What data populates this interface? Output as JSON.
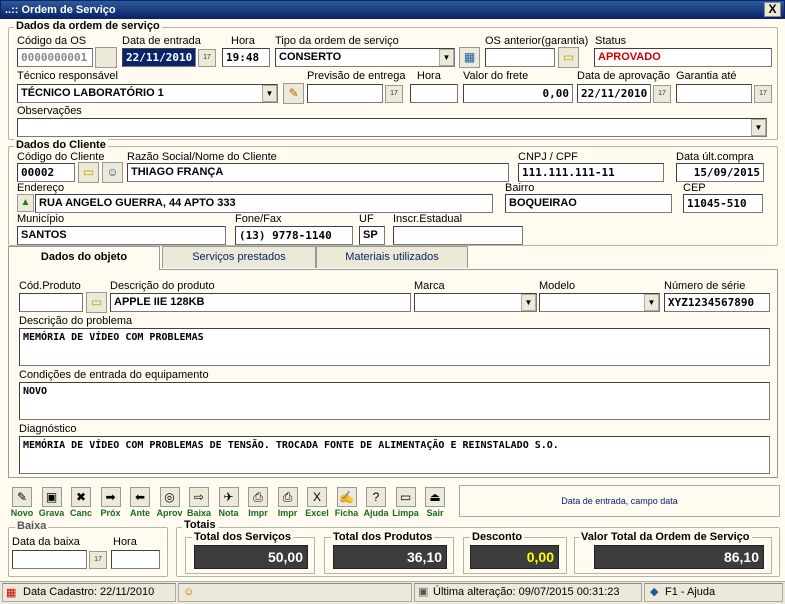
{
  "window": {
    "title": "..:: Ordem de Serviço",
    "close": "X"
  },
  "os": {
    "legend": "Dados da ordem de serviço",
    "codigo_label": "Código da OS",
    "codigo_value": "0000000001",
    "data_entrada_label": "Data de entrada",
    "data_entrada_value": "22/11/2010",
    "hora_label": "Hora",
    "hora_value": "19:48",
    "tipo_label": "Tipo da ordem de serviço",
    "tipo_value": "CONSERTO",
    "os_anterior_label": "OS anterior(garantia)",
    "os_anterior_value": "",
    "status_label": "Status",
    "status_value": "APROVADO",
    "tecnico_label": "Técnico responsável",
    "tecnico_value": "TÉCNICO LABORATÓRIO 1",
    "previsao_label": "Previsão de entrega",
    "previsao_value": "",
    "hora2_label": "Hora",
    "hora2_value": "",
    "frete_label": "Valor do frete",
    "frete_value": "0,00",
    "aprovacao_label": "Data de aprovação",
    "aprovacao_value": "22/11/2010",
    "garantia_label": "Garantia até",
    "garantia_value": "",
    "obs_label": "Observações",
    "obs_value": ""
  },
  "cliente": {
    "legend": "Dados do Cliente",
    "codigo_label": "Código do Cliente",
    "codigo_value": "00002",
    "razao_label": "Razão Social/Nome do Cliente",
    "razao_value": "THIAGO FRANÇA",
    "cnpj_label": "CNPJ / CPF",
    "cnpj_value": "111.111.111-11",
    "ultcompra_label": "Data últ.compra",
    "ultcompra_value": "15/09/2015",
    "endereco_label": "Endereço",
    "endereco_value": "RUA ANGELO GUERRA, 44 APTO 333",
    "bairro_label": "Bairro",
    "bairro_value": "BOQUEIRAO",
    "cep_label": "CEP",
    "cep_value": "11045-510",
    "municipio_label": "Município",
    "municipio_value": "SANTOS",
    "fone_label": "Fone/Fax",
    "fone_value": "(13) 9778-1140",
    "uf_label": "UF",
    "uf_value": "SP",
    "ie_label": "Inscr.Estadual",
    "ie_value": ""
  },
  "tabs": [
    {
      "label": "Dados do objeto"
    },
    {
      "label": "Serviços prestados"
    },
    {
      "label": "Materiais utilizados"
    }
  ],
  "objeto": {
    "cod_label": "Cód.Produto",
    "cod_value": "",
    "desc_label": "Descrição do produto",
    "desc_value": "APPLE IIE 128KB",
    "marca_label": "Marca",
    "marca_value": "",
    "modelo_label": "Modelo",
    "modelo_value": "",
    "serie_label": "Número de série",
    "serie_value": "XYZ1234567890",
    "problema_label": "Descrição do problema",
    "problema_value": "MEMÓRIA DE VÍDEO COM PROBLEMAS",
    "condicoes_label": "Condições de entrada do equipamento",
    "condicoes_value": "NOVO",
    "diagnostico_label": "Diagnóstico",
    "diagnostico_value": "MEMÓRIA DE VÍDEO COM PROBLEMAS DE TENSÃO. TROCADA FONTE DE ALIMENTAÇÃO E REINSTALADO S.O."
  },
  "toolbar": {
    "buttons": [
      {
        "label": "Novo",
        "icon": "✎"
      },
      {
        "label": "Grava",
        "icon": "▣"
      },
      {
        "label": "Canc",
        "icon": "✖"
      },
      {
        "label": "Próx",
        "icon": "➡"
      },
      {
        "label": "Ante",
        "icon": "⬅"
      },
      {
        "label": "Aprov",
        "icon": "◎"
      },
      {
        "label": "Baixa",
        "icon": "⇨"
      },
      {
        "label": "Nota",
        "icon": "✈"
      },
      {
        "label": "Impr",
        "icon": "⎙"
      },
      {
        "label": "Impr",
        "icon": "⎙"
      },
      {
        "label": "Excel",
        "icon": "X"
      },
      {
        "label": "Ficha",
        "icon": "✍"
      },
      {
        "label": "Ajuda",
        "icon": "?"
      },
      {
        "label": "Limpa",
        "icon": "▭"
      },
      {
        "label": "Sair",
        "icon": "⏏"
      }
    ],
    "hint": "Data de entrada, campo data"
  },
  "baixa": {
    "legend": "Baixa",
    "data_label": "Data da baixa",
    "data_value": "",
    "hora_label": "Hora",
    "hora_value": ""
  },
  "totais": {
    "legend": "Totais",
    "servicos_label": "Total dos Serviços",
    "servicos_value": "50,00",
    "produtos_label": "Total dos Produtos",
    "produtos_value": "36,10",
    "desconto_label": "Desconto",
    "desconto_value": "0,00",
    "total_label": "Valor Total da Ordem de Serviço",
    "total_value": "86,10"
  },
  "status": {
    "cadastro": "Data Cadastro: 22/11/2010",
    "alteracao": "Última alteração: 09/07/2015 00:31:23",
    "ajuda": "F1 - Ajuda"
  }
}
